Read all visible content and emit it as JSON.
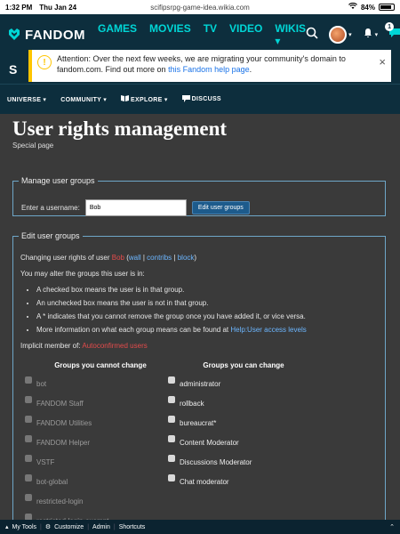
{
  "status_bar": {
    "time": "1:32 PM",
    "date": "Thu Jan 24",
    "url": "scifipsrpg-game-idea.wikia.com",
    "battery": "84%"
  },
  "fandom_nav": {
    "logo_text": "FANDOM",
    "links": [
      "GAMES",
      "MOVIES",
      "TV",
      "VIDEO",
      "WIKIS ▾"
    ],
    "notification_count": "1"
  },
  "banner": {
    "text": "Attention: Over the next few weeks, we are migrating your community's domain to fandom.com. Find out more on ",
    "link_text": "this Fandom help page",
    "suffix": ".",
    "close_symbol": "×"
  },
  "community_nav": {
    "items": [
      "UNIVERSE ▾",
      "COMMUNITY ▾",
      "EXPLORE ▾",
      "DISCUSS"
    ]
  },
  "page": {
    "title": "User rights management",
    "subtitle": "Special page"
  },
  "manage_groups": {
    "legend": "Manage user groups",
    "label": "Enter a username:",
    "input_value": "Bob",
    "button_label": "Edit user groups"
  },
  "edit_groups": {
    "legend": "Edit user groups",
    "changing_prefix": "Changing user rights of user ",
    "username": "Bob",
    "links": {
      "wall": "wall",
      "contribs": "contribs",
      "block": "block"
    },
    "may_alter": "You may alter the groups this user is in:",
    "bullets": [
      "A checked box means the user is in that group.",
      "An unchecked box means the user is not in that group.",
      "A * indicates that you cannot remove the group once you have added it, or vice versa.",
      "More information on what each group means can be found at "
    ],
    "help_link": "Help:User access levels",
    "implicit_prefix": "Implicit member of: ",
    "implicit_group": "Autoconfirmed users",
    "cannot_change_header": "Groups you cannot change",
    "can_change_header": "Groups you can change",
    "cannot_change": [
      "bot",
      "FANDOM Staff",
      "FANDOM Utilities",
      "FANDOM Helper",
      "VSTF",
      "bot-global",
      "restricted-login",
      "restricted-login-exempt"
    ],
    "can_change": [
      "administrator",
      "rollback",
      "bureaucrat*",
      "Content Moderator",
      "Discussions Moderator",
      "Chat moderator"
    ]
  },
  "toolbar": {
    "my_tools": "My Tools",
    "customize": "Customize",
    "admin": "Admin",
    "shortcuts": "Shortcuts"
  },
  "colors": {
    "nav_bg": "#0d2e3d",
    "accent": "#00d6d6",
    "banner_accent": "#ffc500",
    "link": "#6cb6ff",
    "user_red": "#e34b4b"
  }
}
